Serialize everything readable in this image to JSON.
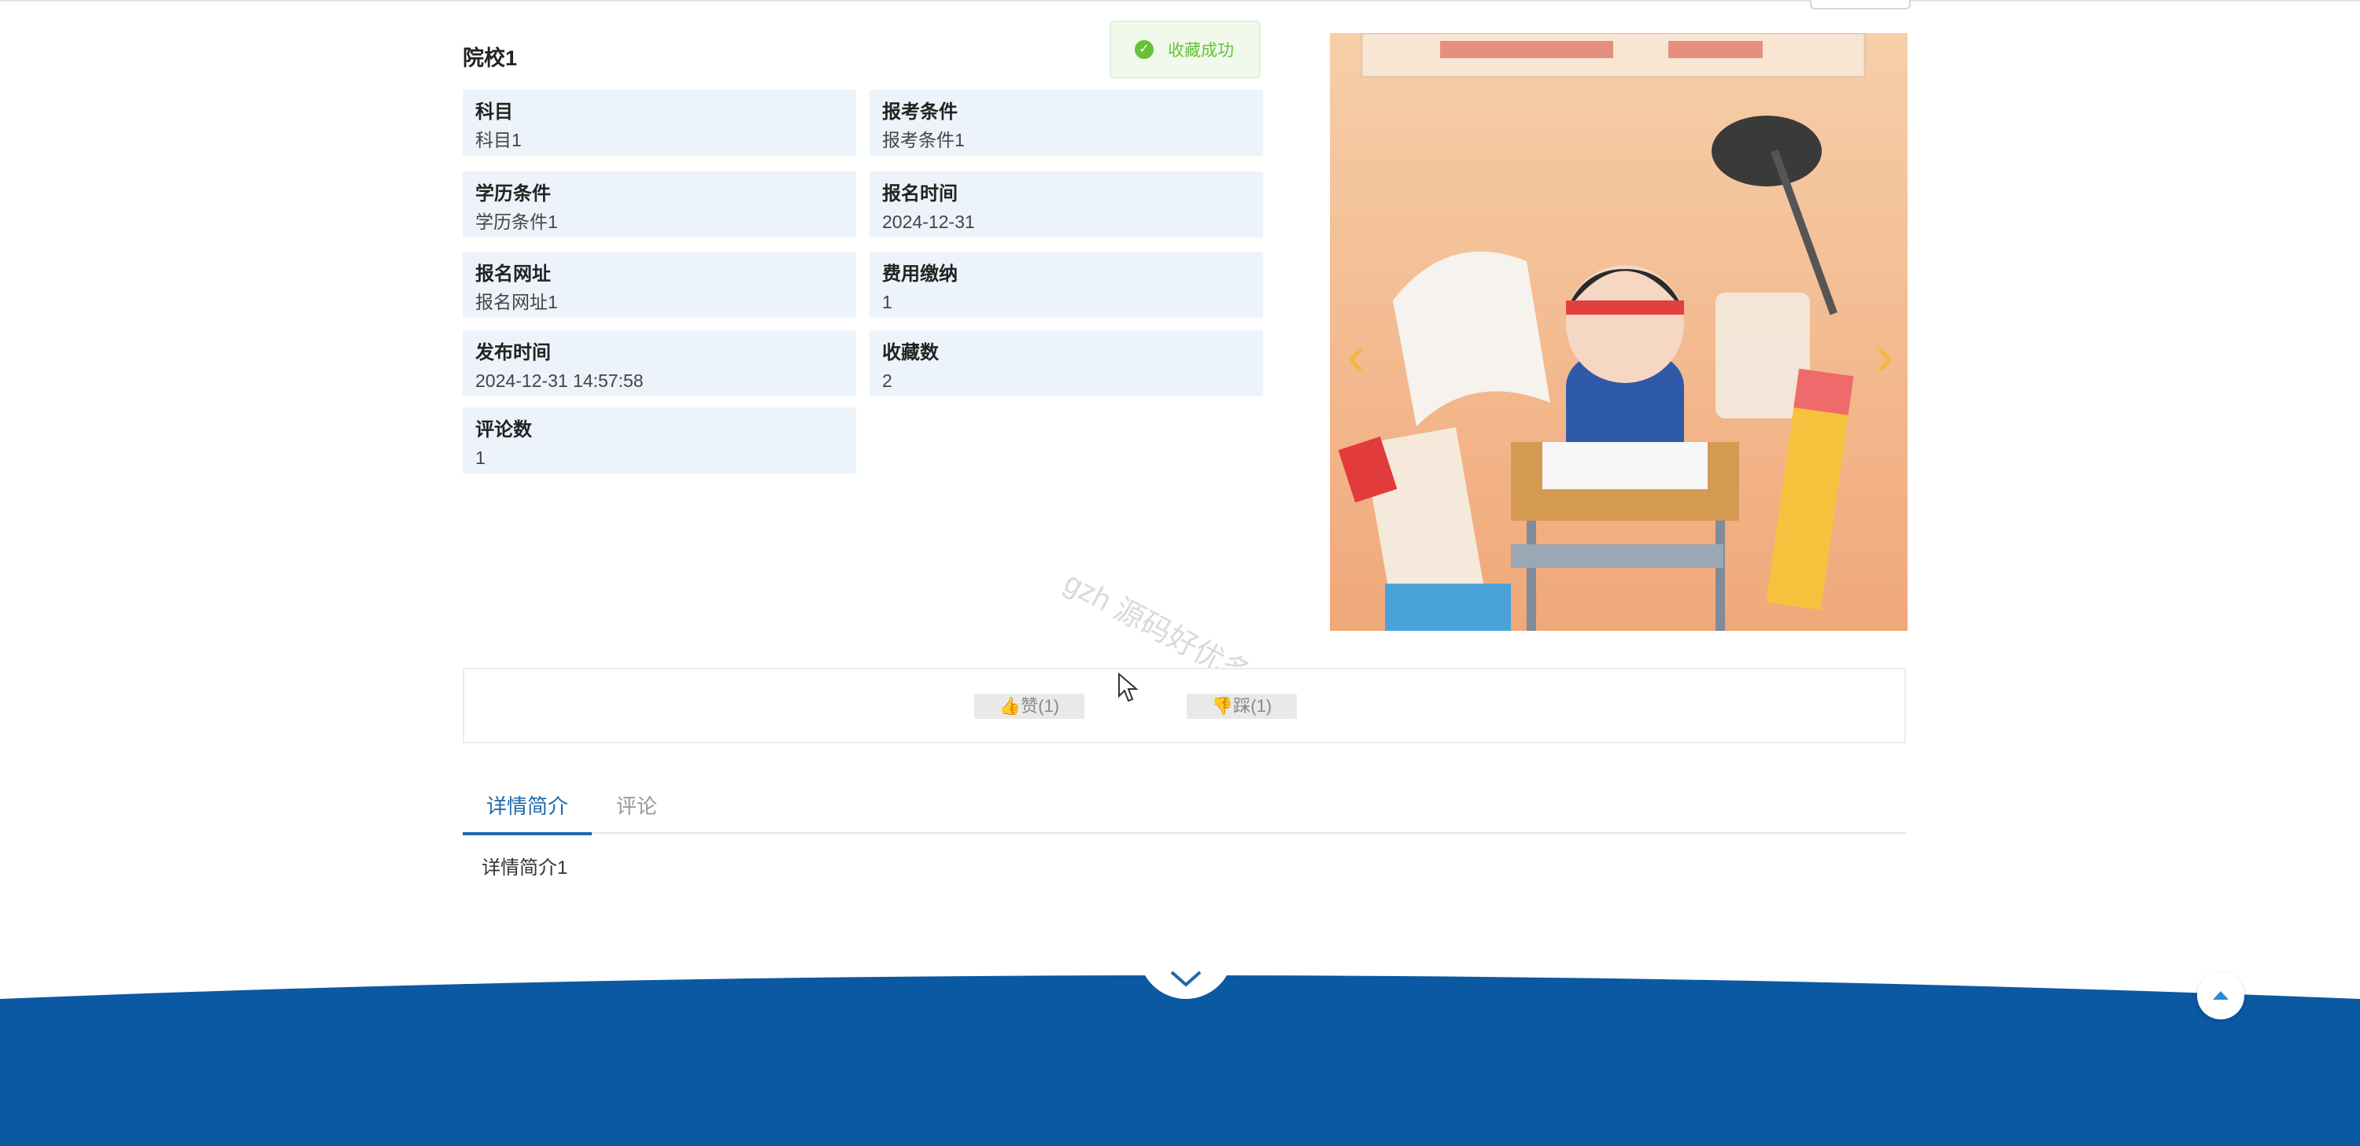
{
  "school": {
    "title": "院校1"
  },
  "toast": {
    "message": "收藏成功",
    "icon": "check-circle-icon"
  },
  "info": [
    {
      "label": "科目",
      "value": "科目1"
    },
    {
      "label": "报考条件",
      "value": "报考条件1"
    },
    {
      "label": "学历条件",
      "value": "学历条件1"
    },
    {
      "label": "报名时间",
      "value": "2024-12-31"
    },
    {
      "label": "报名网址",
      "value": "报名网址1"
    },
    {
      "label": "费用缴纳",
      "value": "1"
    },
    {
      "label": "发布时间",
      "value": "2024-12-31 14:57:58"
    },
    {
      "label": "收藏数",
      "value": "2"
    },
    {
      "label": "评论数",
      "value": "1"
    }
  ],
  "watermark": "gzh 源码好优多",
  "votes": {
    "like_label": "赞(1)",
    "dislike_label": "踩(1)"
  },
  "tabs": [
    {
      "label": "详情简介",
      "active": true
    },
    {
      "label": "评论",
      "active": false
    }
  ],
  "detail": {
    "text": "详情简介1"
  },
  "colors": {
    "accent": "#1e6aa8",
    "footer": "#0b58a3",
    "info_bg": "#edf3fa",
    "success": "#67c23a"
  }
}
